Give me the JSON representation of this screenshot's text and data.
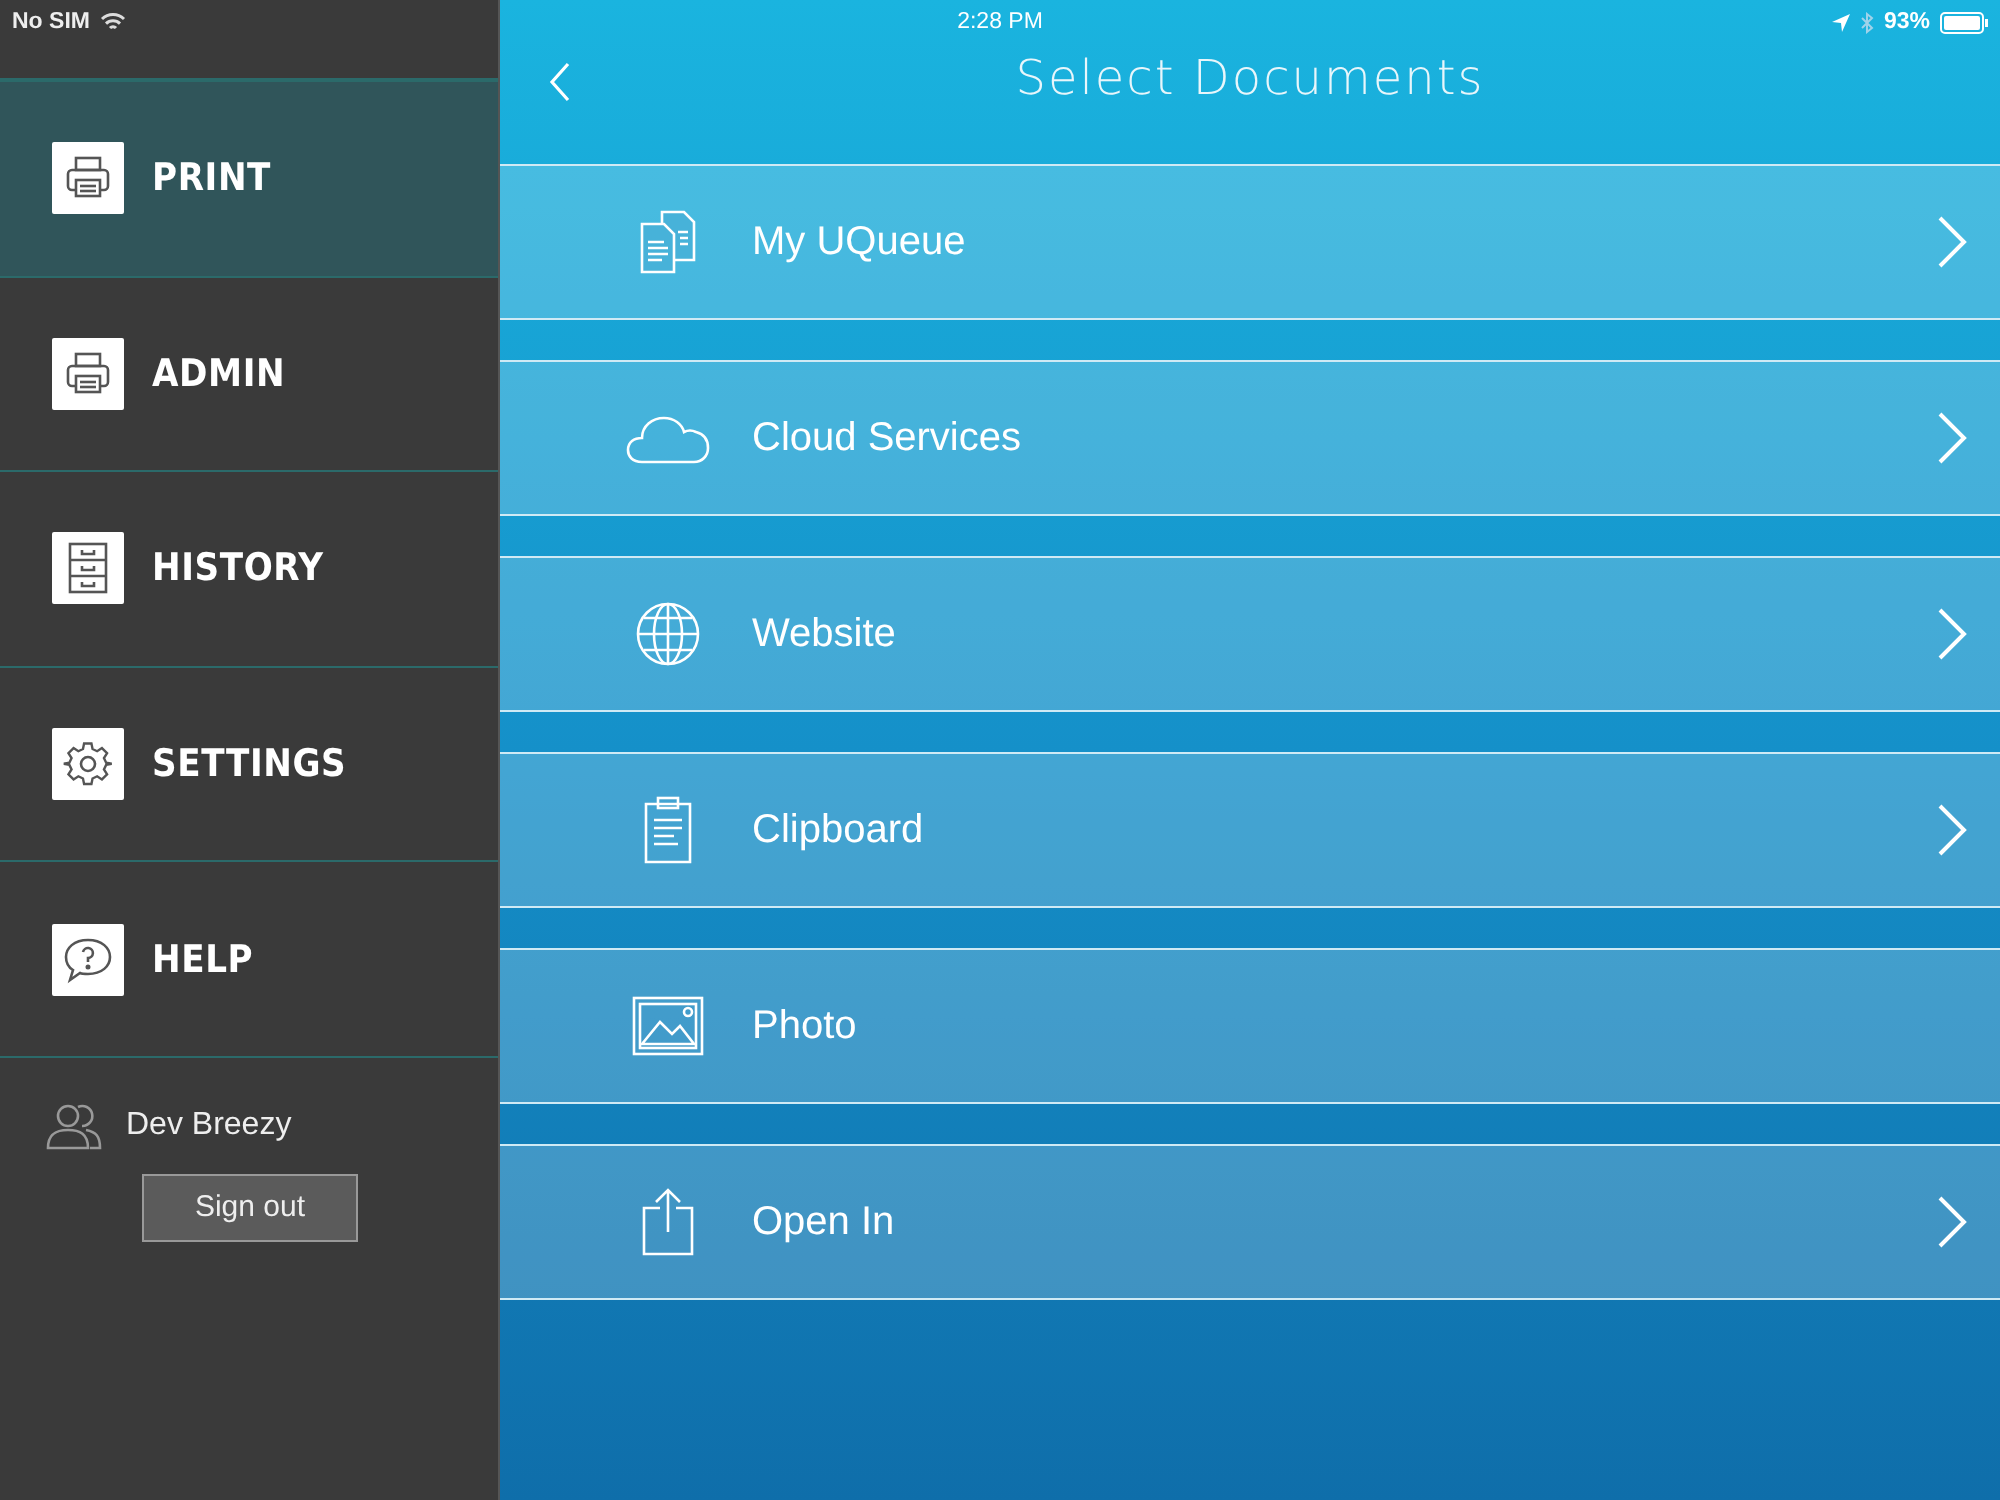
{
  "status_bar": {
    "carrier": "No SIM",
    "time": "2:28 PM",
    "battery": "93%"
  },
  "sidebar": {
    "items": [
      {
        "label": "PRINT",
        "selected": true
      },
      {
        "label": "ADMIN",
        "selected": false
      },
      {
        "label": "HISTORY",
        "selected": false
      },
      {
        "label": "SETTINGS",
        "selected": false
      },
      {
        "label": "HELP",
        "selected": false
      }
    ],
    "user": {
      "name": "Dev Breezy"
    },
    "sign_out": "Sign out"
  },
  "header": {
    "title": "Select Documents"
  },
  "sources": [
    {
      "label": "My UQueue",
      "chevron": true
    },
    {
      "label": "Cloud Services",
      "chevron": true
    },
    {
      "label": "Website",
      "chevron": true
    },
    {
      "label": "Clipboard",
      "chevron": true
    },
    {
      "label": "Photo",
      "chevron": false
    },
    {
      "label": "Open In",
      "chevron": true
    }
  ]
}
